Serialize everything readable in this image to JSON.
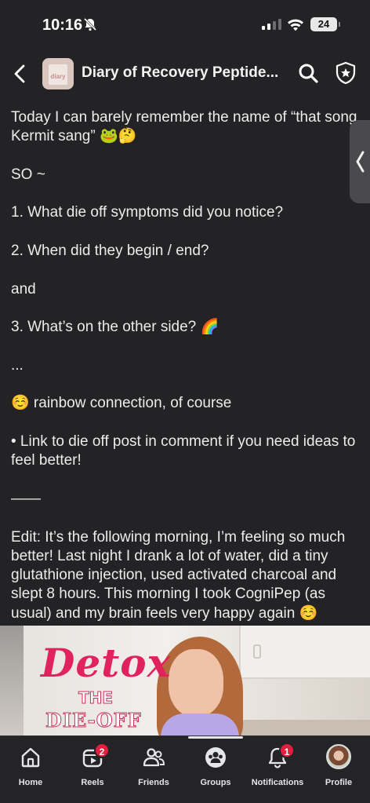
{
  "status_bar": {
    "time": "10:16",
    "battery": "24"
  },
  "header": {
    "group_name": "Diary of Recovery Peptide...",
    "avatar_text": "diary"
  },
  "post": {
    "lines": [
      "Today I can barely remember the name of “that song Kermit sang” 🐸🤔",
      "SO ~",
      "1. What die off symptoms did you notice?",
      "2. When did they begin / end?",
      "and",
      "3. What’s on the other side? 🌈",
      "...",
      "☺️ rainbow connection, of course",
      "• Link to die off post in comment if you need ideas to feel better!",
      "——",
      "Edit: It’s the following morning, I’m feeling so much better! Last night I drank a lot of water, did a tiny glutathione injection, used activated charcoal and slept 8 hours. This morning I took CogniPep (as usual) and my brain feels very happy again ☺️"
    ]
  },
  "image": {
    "title_line1": "Detox",
    "title_line2": "THE",
    "title_line3": "DIE-OFF"
  },
  "nav": {
    "home": "Home",
    "reels": "Reels",
    "reels_badge": "2",
    "friends": "Friends",
    "groups": "Groups",
    "notifications": "Notifications",
    "notifications_badge": "1",
    "profile": "Profile"
  },
  "colors": {
    "background": "#232325",
    "badge": "#e41e3f",
    "text": "#ececec"
  }
}
